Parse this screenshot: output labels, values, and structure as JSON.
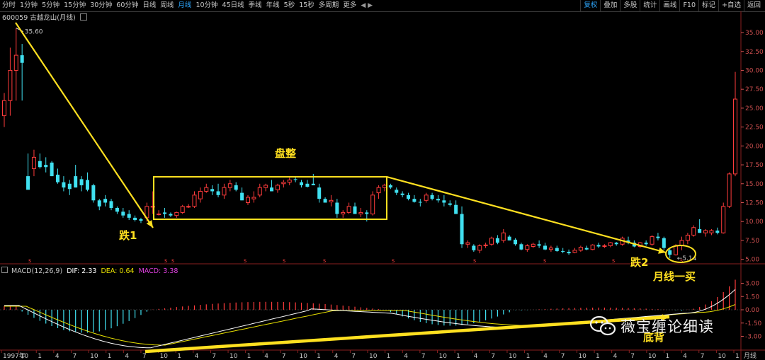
{
  "toolbar": {
    "tabs": [
      "分时",
      "1分钟",
      "5分钟",
      "15分钟",
      "30分钟",
      "60分钟",
      "日线",
      "周线",
      "月线",
      "10分钟",
      "45日线",
      "季线",
      "年线",
      "5秒",
      "15秒",
      "多周期",
      "更多"
    ],
    "active_tab": "月线",
    "right_buttons": [
      "复权",
      "叠加",
      "多股",
      "统计",
      "画线",
      "F10",
      "标记",
      "+自选",
      "返回"
    ],
    "highlight_buttons": [
      "复权"
    ]
  },
  "stock": {
    "code": "600059",
    "name": "古越龙山(月线)"
  },
  "price_axis": {
    "ticks": [
      "35.00",
      "32.50",
      "30.00",
      "27.50",
      "25.00",
      "22.50",
      "20.00",
      "17.50",
      "15.00",
      "12.50",
      "10.00",
      "7.50",
      "5.00"
    ],
    "color": "#d05050"
  },
  "macd": {
    "label": "MACD(12,26,9)",
    "dif_label": "DIF:",
    "dif": "2.33",
    "dea_label": "DEA:",
    "dea": "0.64",
    "macd_label": "MACD:",
    "macd_value": "3.38",
    "axis_ticks": [
      "3.00",
      "1.50",
      "0.00",
      "-1.50",
      "-3.00"
    ]
  },
  "time_axis": {
    "labels": [
      "1997年",
      "10",
      "1",
      "4",
      "7",
      "10",
      "1",
      "4",
      "7",
      "10",
      "1",
      "4",
      "7",
      "10",
      "1",
      "4",
      "7",
      "10",
      "1",
      "4",
      "7",
      "10",
      "1",
      "4",
      "7",
      "10",
      "1",
      "4",
      "7",
      "10",
      "1",
      "4",
      "7",
      "10",
      "1",
      "4",
      "7",
      "10",
      "1",
      "4",
      "7",
      "10",
      "1"
    ],
    "period_label": "月线"
  },
  "price_markers": {
    "high": "35.60",
    "low": "5.14"
  },
  "annotations": {
    "drop1": "跌1",
    "consolidation": "盘整",
    "drop2": "跌2",
    "monthly_buy": "月线一买",
    "bottom_divergence": "底背"
  },
  "watermark": "薇宝缠论细读",
  "colors": {
    "up": "#ff3c3c",
    "down": "#40e0f0",
    "annotation": "#ffe020",
    "dif": "#ffffff",
    "dea": "#e8e000"
  },
  "chart_data": {
    "type": "candlestick",
    "period": "monthly",
    "ylim": [
      4.5,
      36.5
    ],
    "ohlc": [
      [
        24,
        27,
        22.5,
        26
      ],
      [
        26,
        33,
        24,
        30
      ],
      [
        30,
        35.6,
        26,
        32
      ],
      [
        32,
        33.5,
        26,
        31
      ],
      [
        16,
        19,
        14.5,
        14.2
      ],
      [
        17,
        19.5,
        16,
        18.5
      ],
      [
        18,
        19,
        17,
        17.2
      ],
      [
        17.5,
        18.5,
        16.5,
        17.2
      ],
      [
        17.8,
        18,
        16,
        16
      ],
      [
        16.2,
        17,
        15,
        15.2
      ],
      [
        15.2,
        16,
        14,
        14.5
      ],
      [
        15,
        15.5,
        13.5,
        14.3
      ],
      [
        16,
        17.5,
        14.5,
        14.5
      ],
      [
        15.6,
        16,
        14,
        14.8
      ],
      [
        15.5,
        16.5,
        14,
        14.2
      ],
      [
        14.8,
        15,
        12.5,
        12.8
      ],
      [
        12.8,
        13,
        11.5,
        12
      ],
      [
        13,
        13.5,
        12,
        12.5
      ],
      [
        12.7,
        13,
        11.5,
        11.8
      ],
      [
        11.8,
        12,
        11,
        11.3
      ],
      [
        11.3,
        11.8,
        10.5,
        10.8
      ],
      [
        11,
        11.5,
        10.2,
        10.5
      ],
      [
        10.5,
        10.8,
        10,
        10.2
      ],
      [
        10.3,
        10.5,
        9.8,
        10.1
      ],
      [
        10.5,
        12.5,
        10,
        12
      ],
      [
        12,
        14,
        11,
        12
      ],
      [
        11,
        11.5,
        10.8,
        11
      ],
      [
        11.2,
        11.8,
        10.5,
        11
      ],
      [
        11,
        11.2,
        10.6,
        10.8
      ],
      [
        10.8,
        11.3,
        10.5,
        11.2
      ],
      [
        11.2,
        12.2,
        11,
        12
      ],
      [
        12,
        12.3,
        11.8,
        12
      ],
      [
        12,
        14,
        11.8,
        13.5
      ],
      [
        13,
        14.5,
        12.5,
        14
      ],
      [
        14,
        15,
        13.8,
        14.5
      ],
      [
        14.3,
        14.8,
        13.5,
        14
      ],
      [
        14,
        15,
        13.2,
        13.5
      ],
      [
        13.5,
        15,
        13,
        14.5
      ],
      [
        14.5,
        15.5,
        14,
        15
      ],
      [
        14.8,
        15.2,
        14,
        14.2
      ],
      [
        13.8,
        14.5,
        12.8,
        12.8
      ],
      [
        12.5,
        13.5,
        12.2,
        13.2
      ],
      [
        13,
        14,
        12.5,
        13.2
      ],
      [
        13.5,
        15,
        13.2,
        14.5
      ],
      [
        14.5,
        15,
        14,
        14.8
      ],
      [
        14.5,
        15.5,
        14,
        14
      ],
      [
        14.2,
        15,
        13.8,
        14.8
      ],
      [
        15,
        15.5,
        14.5,
        15.2
      ],
      [
        15.2,
        15.8,
        14.8,
        15.5
      ],
      [
        15.6,
        16,
        15.2,
        15.5
      ],
      [
        15.2,
        15.5,
        14.5,
        14.8
      ],
      [
        15,
        15.5,
        14.5,
        14.6
      ],
      [
        15,
        16.3,
        14.8,
        14.8
      ],
      [
        14.5,
        15,
        12.5,
        13
      ],
      [
        13,
        13.2,
        12.5,
        12.5
      ],
      [
        12.6,
        13.5,
        12,
        12.8
      ],
      [
        12.5,
        13,
        10.5,
        11
      ],
      [
        11,
        11.5,
        10.5,
        11.2
      ],
      [
        11.2,
        12.5,
        11,
        12
      ],
      [
        12,
        12.5,
        11,
        11
      ],
      [
        11,
        11.8,
        10.6,
        11.2
      ],
      [
        11.2,
        11.5,
        10,
        11
      ],
      [
        11,
        14,
        10.8,
        13.5
      ],
      [
        13.8,
        14.8,
        13,
        14.5
      ],
      [
        14.5,
        15,
        14,
        14.8
      ],
      [
        14.8,
        15,
        14.3,
        14.5
      ],
      [
        14.2,
        14.5,
        13.5,
        13.8
      ],
      [
        13.7,
        14,
        13.2,
        13.5
      ],
      [
        13.5,
        13.8,
        12.8,
        13
      ],
      [
        13,
        13.5,
        12.5,
        12.6
      ],
      [
        12.6,
        13,
        12,
        12.5
      ],
      [
        12.8,
        13.8,
        12.5,
        13.5
      ],
      [
        13.5,
        13.8,
        12.8,
        13
      ],
      [
        13,
        13.5,
        12.5,
        12.8
      ],
      [
        12.8,
        13.5,
        12,
        12.5
      ],
      [
        12.4,
        12.8,
        12,
        12.2
      ],
      [
        12.2,
        12.8,
        11,
        11
      ],
      [
        11,
        12,
        6.5,
        7
      ],
      [
        7,
        7.5,
        6.5,
        7.2
      ],
      [
        6.8,
        7,
        6,
        6.2
      ],
      [
        6.2,
        7,
        5.8,
        6.8
      ],
      [
        6.8,
        7.2,
        6.5,
        6.9
      ],
      [
        7,
        8,
        6.8,
        7.8
      ],
      [
        7.8,
        8.2,
        7,
        7.2
      ],
      [
        7.5,
        9,
        7.2,
        8.5
      ],
      [
        8,
        8.2,
        7.5,
        7.5
      ],
      [
        7.6,
        7.8,
        6.8,
        7
      ],
      [
        7,
        7.2,
        6.2,
        6.3
      ],
      [
        6.3,
        7,
        6,
        6.8
      ],
      [
        6.7,
        7.2,
        6.5,
        7
      ],
      [
        7,
        7.5,
        6.5,
        6.8
      ],
      [
        6.8,
        7.2,
        6.2,
        6.3
      ],
      [
        6.3,
        6.8,
        6,
        6.5
      ],
      [
        6.5,
        6.8,
        6,
        6.1
      ],
      [
        6.1,
        6.5,
        5.8,
        6
      ],
      [
        6,
        6.3,
        5.6,
        5.8
      ],
      [
        5.9,
        6.5,
        5.8,
        6.2
      ],
      [
        6.2,
        6.8,
        6,
        6.6
      ],
      [
        6.5,
        6.8,
        6.2,
        6.3
      ],
      [
        6.3,
        7,
        6.2,
        6.9
      ],
      [
        6.9,
        7.2,
        6.5,
        6.7
      ],
      [
        6.7,
        7,
        6.5,
        6.8
      ],
      [
        6.8,
        7.3,
        6.6,
        7.2
      ],
      [
        7.2,
        7.3,
        6.8,
        7
      ],
      [
        7,
        8,
        6.8,
        7.8
      ],
      [
        7.5,
        8,
        7,
        7.2
      ],
      [
        7.2,
        7.5,
        6.6,
        6.7
      ],
      [
        6.7,
        7.3,
        6.5,
        7.2
      ],
      [
        7.2,
        7.5,
        6.8,
        7
      ],
      [
        7,
        8.2,
        6.8,
        8
      ],
      [
        8,
        8.5,
        7.5,
        7.8
      ],
      [
        7.8,
        8,
        6.2,
        6.5
      ],
      [
        6.2,
        6.5,
        5.14,
        5.6
      ],
      [
        5.6,
        7,
        5.5,
        6.8
      ],
      [
        6.8,
        8,
        6.2,
        7.5
      ],
      [
        7.5,
        8.5,
        7,
        8.2
      ],
      [
        8.2,
        9.5,
        8,
        9.2
      ],
      [
        9,
        10.3,
        8.5,
        8.5
      ],
      [
        8.5,
        9,
        8,
        8.8
      ],
      [
        8.5,
        9,
        8.2,
        8.8
      ],
      [
        8.8,
        9.2,
        8.3,
        8.5
      ],
      [
        8.5,
        12.5,
        8.4,
        12
      ],
      [
        12,
        16.5,
        11.8,
        16.3
      ],
      [
        16.3,
        29.8,
        16,
        26.2
      ]
    ],
    "macd_axis_range": [
      -3.8,
      3.8
    ]
  }
}
